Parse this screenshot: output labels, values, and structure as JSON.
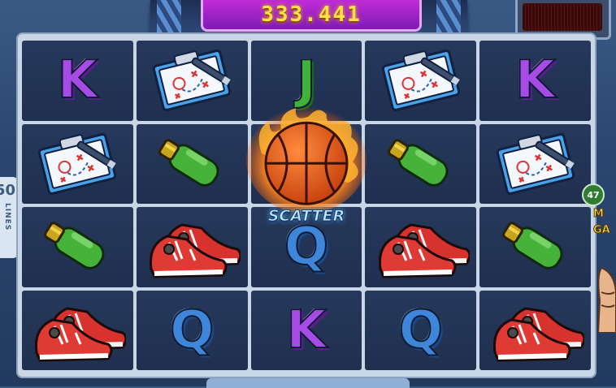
{
  "win_display": {
    "value": "333.441"
  },
  "lines_tag": {
    "number": "50",
    "label": "LINES"
  },
  "scatter": {
    "label": "SCATTER"
  },
  "feature_badge": {
    "count": "47",
    "text_line1": "M",
    "text_line2": "GA"
  },
  "reels": [
    [
      "K",
      "clipboard",
      "J",
      "clipboard",
      "K"
    ],
    [
      "clipboard",
      "bottle",
      "scatter",
      "bottle",
      "clipboard"
    ],
    [
      "bottle",
      "sneakers",
      "Q",
      "sneakers",
      "bottle"
    ],
    [
      "sneakers",
      "Q",
      "K",
      "Q",
      "sneakers"
    ]
  ],
  "colors": {
    "letter_k": "#a64be6",
    "letter_q": "#3e86d9",
    "letter_j": "#3fb23a",
    "win_text": "#ffe14a",
    "win_panel": "#c02bd6"
  }
}
